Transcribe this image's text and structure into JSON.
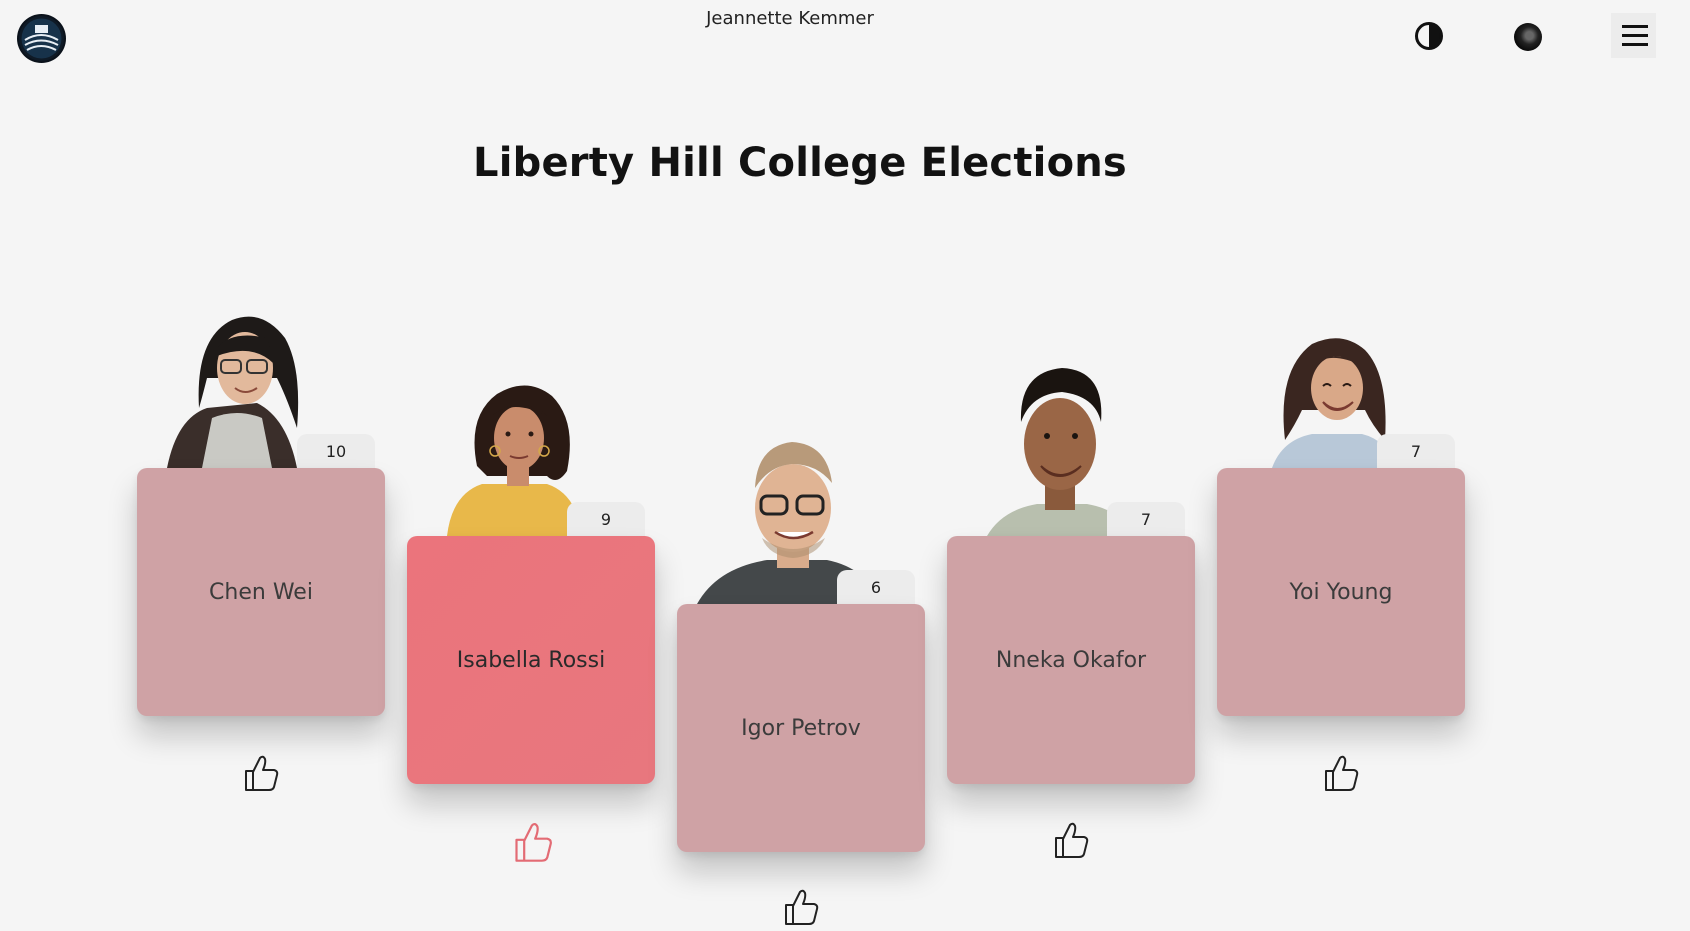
{
  "header": {
    "user_name": "Jeannette Kemmer",
    "logo_icon": "college-seal-logo",
    "contrast_icon": "contrast-toggle-icon",
    "avatar_icon": "user-avatar",
    "menu_icon": "hamburger-menu-icon"
  },
  "page": {
    "title": "Liberty Hill College Elections"
  },
  "colors": {
    "card": "#cfa2a5",
    "card_selected": "#eb747c",
    "like_selected": "#e36b74",
    "background": "#f5f5f5"
  },
  "candidates": [
    {
      "name": "Chen Wei",
      "votes": "10",
      "selected": false
    },
    {
      "name": "Isabella Rossi",
      "votes": "9",
      "selected": true
    },
    {
      "name": "Igor Petrov",
      "votes": "6",
      "selected": false
    },
    {
      "name": "Nneka Okafor",
      "votes": "7",
      "selected": false
    },
    {
      "name": "Yoi Young",
      "votes": "7",
      "selected": false
    }
  ]
}
